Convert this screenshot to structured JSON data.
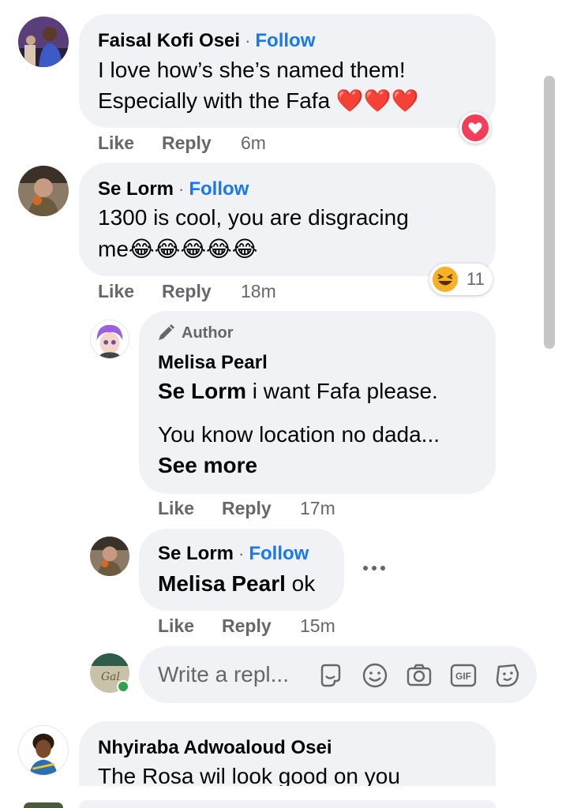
{
  "comments": [
    {
      "author": "Faisal Kofi Osei",
      "follow": "Follow",
      "separator": "·",
      "line1": "I love how’s she’s named them!",
      "line2": "Especially with the Fafa ❤️❤️❤️",
      "like": "Like",
      "reply": "Reply",
      "time": "6m",
      "reaction_icon": "heart-reaction-icon"
    },
    {
      "author": "Se Lorm",
      "follow": "Follow",
      "separator": "·",
      "line1": "1300 is cool, you are disgracing",
      "line2": "me😂😂😂😂😂",
      "like": "Like",
      "reply": "Reply",
      "time": "18m",
      "reaction_icon": "laughing-reaction-icon",
      "reaction_count": "11"
    },
    {
      "author_badge": "Author",
      "author": "Melisa Pearl",
      "mention": "Se Lorm",
      "line1": " i want Fafa please.",
      "line2": "You know location no dada...",
      "see_more": "See more",
      "like": "Like",
      "reply": "Reply",
      "time": "17m"
    },
    {
      "author": "Se Lorm",
      "follow": "Follow",
      "separator": "·",
      "mention": "Melisa Pearl",
      "text": " ok",
      "like": "Like",
      "reply": "Reply",
      "time": "15m",
      "more_icon": "more-options-icon"
    },
    {
      "author": "Nhyiraba Adwoaloud Osei",
      "line1": "The Rosa wil look good on you"
    }
  ],
  "reply_box": {
    "placeholder": "Write a repl...",
    "icons": [
      "sticker-icon",
      "emoji-icon",
      "camera-icon",
      "gif-icon",
      "avatar-sticker-icon"
    ],
    "gif_label": "GIF"
  },
  "colors": {
    "bubble": "#f0f2f5",
    "follow": "#1877f2",
    "meta": "#65676b",
    "heart": "#f33e58",
    "online": "#31a24c"
  }
}
